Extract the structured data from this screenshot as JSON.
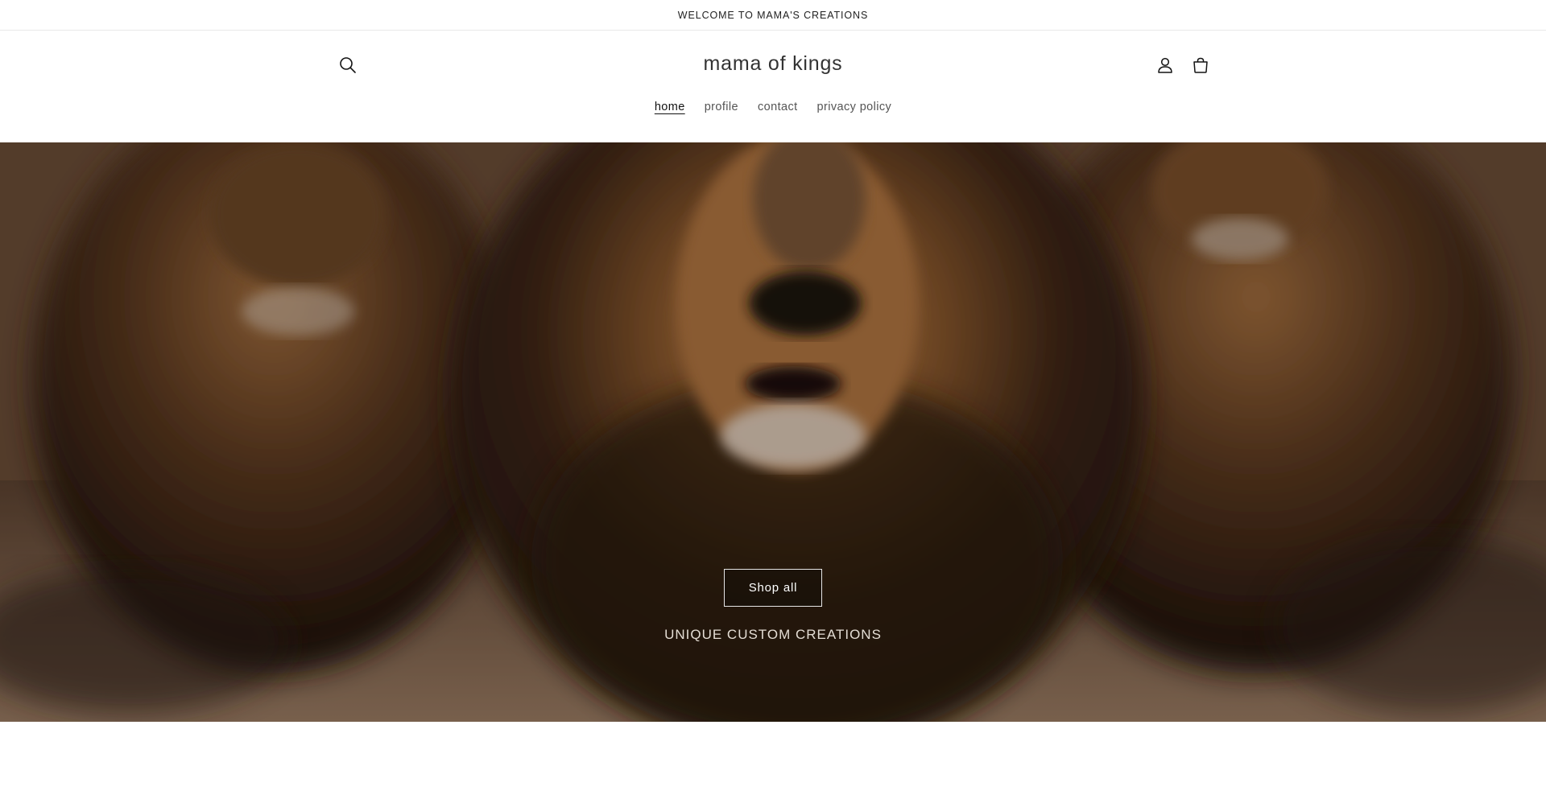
{
  "announcement": {
    "text": "WELCOME TO MAMA'S CREATIONS"
  },
  "header": {
    "site_title": "mama of kings",
    "icons": {
      "search": "search-icon",
      "account": "user-icon",
      "cart": "cart-icon"
    },
    "nav": [
      {
        "label": "home",
        "active": true
      },
      {
        "label": "profile",
        "active": false
      },
      {
        "label": "contact",
        "active": false
      },
      {
        "label": "privacy policy",
        "active": false
      }
    ]
  },
  "hero": {
    "button_label": "Shop all",
    "subheading": "UNIQUE CUSTOM CREATIONS",
    "image": "three-lions-running"
  },
  "colors": {
    "text": "#121212",
    "announcement_border": "#e8e8e8",
    "hero_tone": "#3a2a1d"
  }
}
